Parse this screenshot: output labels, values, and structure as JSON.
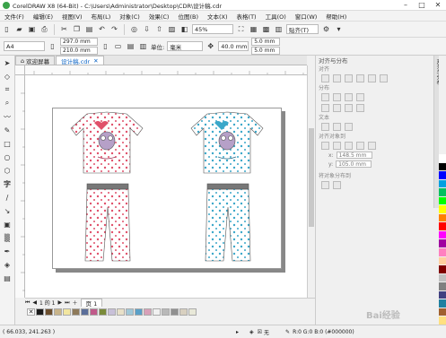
{
  "title": "CorelDRAW X8 (64-Bit) - C:\\Users\\Administrator\\Desktop\\CDR\\设计稿.cdr",
  "menu": [
    "文件(F)",
    "编辑(E)",
    "视图(V)",
    "布局(L)",
    "对象(C)",
    "效果(C)",
    "位图(B)",
    "文本(X)",
    "表格(T)",
    "工具(O)",
    "窗口(W)",
    "帮助(H)"
  ],
  "toolbar": {
    "zoom": "45%",
    "snap": "贴齐(T)"
  },
  "props": {
    "paper": "A4",
    "width": "297.0 mm",
    "height": "210.0 mm",
    "units_label": "单位:",
    "units": "毫米",
    "nudge": "40.0 mm",
    "dup_x": "5.0 mm",
    "dup_y": "5.0 mm"
  },
  "tabs": [
    "欢迎屏幕",
    "设计稿.cdr"
  ],
  "docker": {
    "title": "对齐与分布",
    "align_label": "对齐",
    "distribute_label": "分布",
    "text_label": "文本",
    "align_objects_to": "对齐对象到",
    "x": "148.5 mm",
    "y": "105.0 mm",
    "distribute_to": "将对象分布到"
  },
  "side_tab": "对齐与分布",
  "docnav": {
    "page_info": "1 的 1",
    "page_tab": "页 1"
  },
  "status": {
    "coords": "( 66.033, 241.263 )",
    "fill": "无",
    "color_info": "R:0 G:0 B:0 (#000000)"
  },
  "watermark": "Bai经验",
  "colors": {
    "pink": "#e0506a",
    "cyan": "#3aa7c9",
    "lavender": "#b6a0c8"
  },
  "palette_h": [
    "#1a1a1a",
    "#6b4e2e",
    "#c8b48a",
    "#f2e6a0",
    "#8e7a5a",
    "#5a6e9a",
    "#c05a8a",
    "#7a8a3a",
    "#c8c0d8",
    "#e8e0c8",
    "#a0c8d8",
    "#5aa0c8",
    "#d8a0b8",
    "#f0f0f0",
    "#b8b8b8",
    "#909090",
    "#d8d0c0",
    "#e8e8d8"
  ],
  "palette_v": [
    "#ffffff",
    "#000000",
    "#0000ff",
    "#00a0e0",
    "#00c060",
    "#00ff00",
    "#ffff00",
    "#ff8000",
    "#ff0000",
    "#ff00ff",
    "#a000a0",
    "#ff80c0",
    "#ffd0a0",
    "#800000",
    "#c0c0c0",
    "#808080",
    "#404080",
    "#2080a0",
    "#a06030",
    "#ffe080"
  ]
}
